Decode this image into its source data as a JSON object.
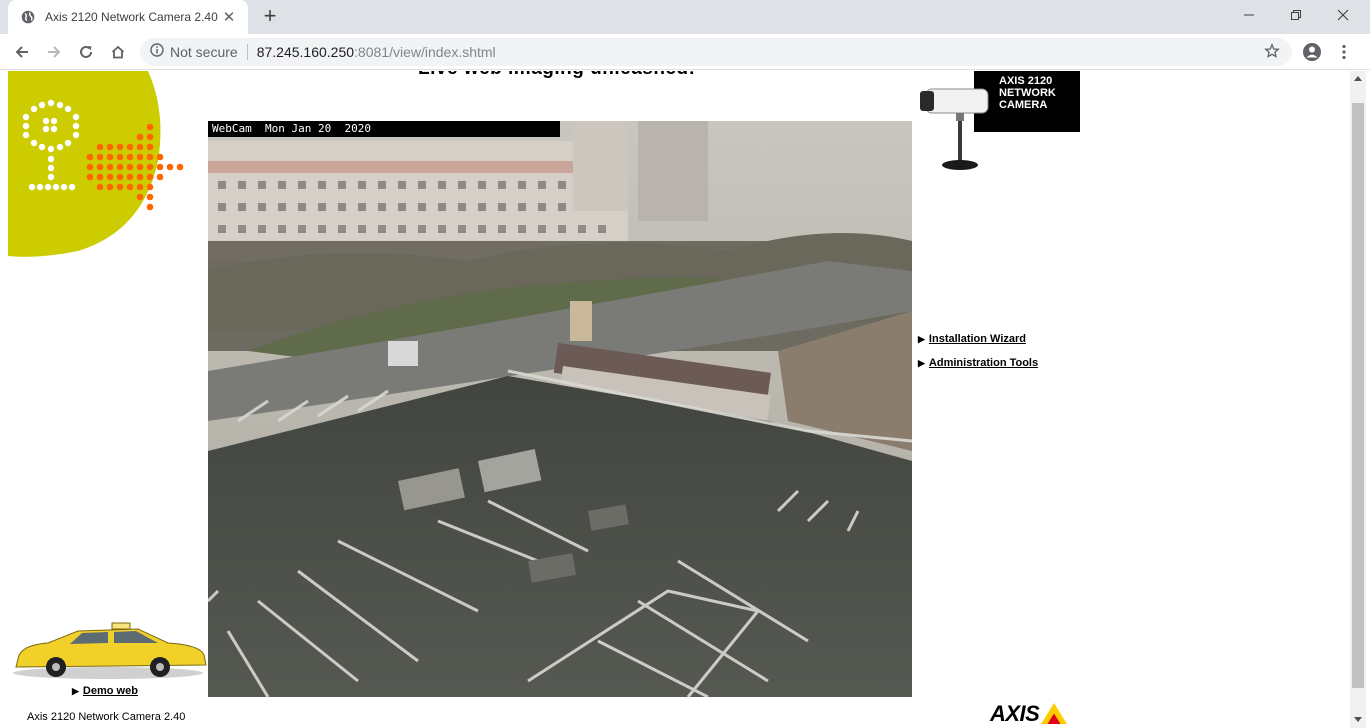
{
  "browser": {
    "tab_title": "Axis 2120 Network Camera 2.40",
    "tab_close": "✕",
    "new_tab": "+",
    "security_label": "Not secure",
    "url_host": "87.245.160.250",
    "url_rest": ":8081/view/index.shtml"
  },
  "page": {
    "headline": "Live web imaging unleashed!",
    "overlay_text": "WebCam  Mon Jan 20  2020",
    "product_badge": [
      "AXIS 2120",
      "NETWORK",
      "CAMERA"
    ],
    "links": [
      {
        "label": "Installation Wizard",
        "marker": "▶"
      },
      {
        "label": "Administration Tools",
        "marker": "▶"
      }
    ],
    "demo": {
      "label": "Demo web",
      "marker": "▶"
    },
    "footer": "Axis 2120 Network Camera 2.40",
    "logo_text": "AXIS"
  },
  "colors": {
    "logo_yellow": "#cccc00",
    "logo_orange": "#ff6600",
    "taxi_yellow": "#f2d02a",
    "axis_red": "#e2001a",
    "axis_yellow": "#ffcc00"
  }
}
